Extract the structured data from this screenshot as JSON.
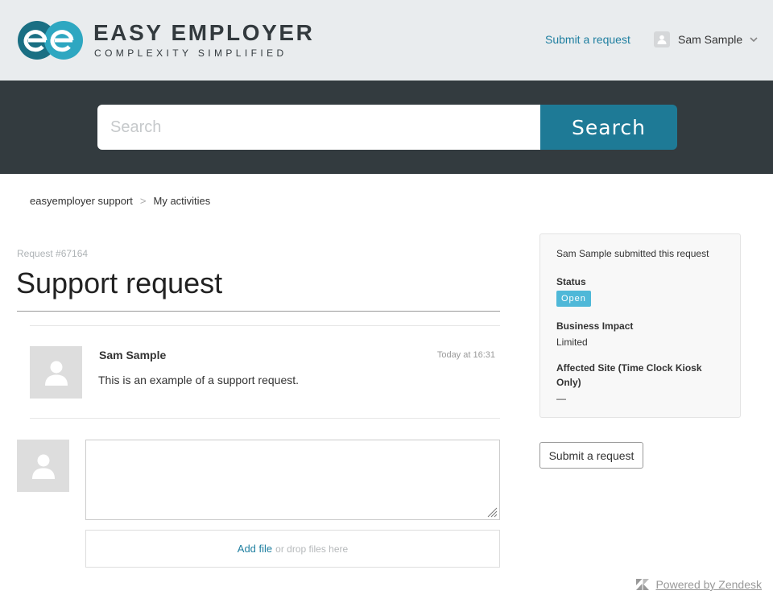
{
  "brand": {
    "name": "EASY EMPLOYER",
    "tagline": "COMPLEXITY SIMPLIFIED",
    "colors": {
      "mark_dark": "#1a6f83",
      "mark_light": "#2ea7c1",
      "accent": "#1e7a96"
    }
  },
  "header": {
    "submit_request_link": "Submit a request",
    "user": {
      "name": "Sam Sample",
      "avatar_icon": "user-icon",
      "menu_icon": "chevron-down-icon"
    }
  },
  "search": {
    "placeholder": "Search",
    "button_label": "Search"
  },
  "breadcrumb": {
    "items": [
      "easyemployer support",
      "My activities"
    ],
    "separator": ">"
  },
  "request": {
    "id_label": "Request #67164",
    "title": "Support request",
    "comments": [
      {
        "author": "Sam Sample",
        "time": "Today at 16:31",
        "body": "This is an example of a support request."
      }
    ],
    "reply": {
      "value": "",
      "add_file_link": "Add file",
      "drop_text": "or drop files here"
    }
  },
  "sidebar": {
    "submitted_by": "Sam Sample submitted this request",
    "fields": [
      {
        "label": "Status",
        "value": "Open",
        "badge_color": "#4fb8d8"
      },
      {
        "label": "Business Impact",
        "value": "Limited"
      },
      {
        "label": "Affected Site (Time Clock Kiosk Only)",
        "value": "—"
      }
    ],
    "submit_button": "Submit a request"
  },
  "footer": {
    "powered_by": "Powered by Zendesk",
    "icon": "zendesk-icon"
  }
}
